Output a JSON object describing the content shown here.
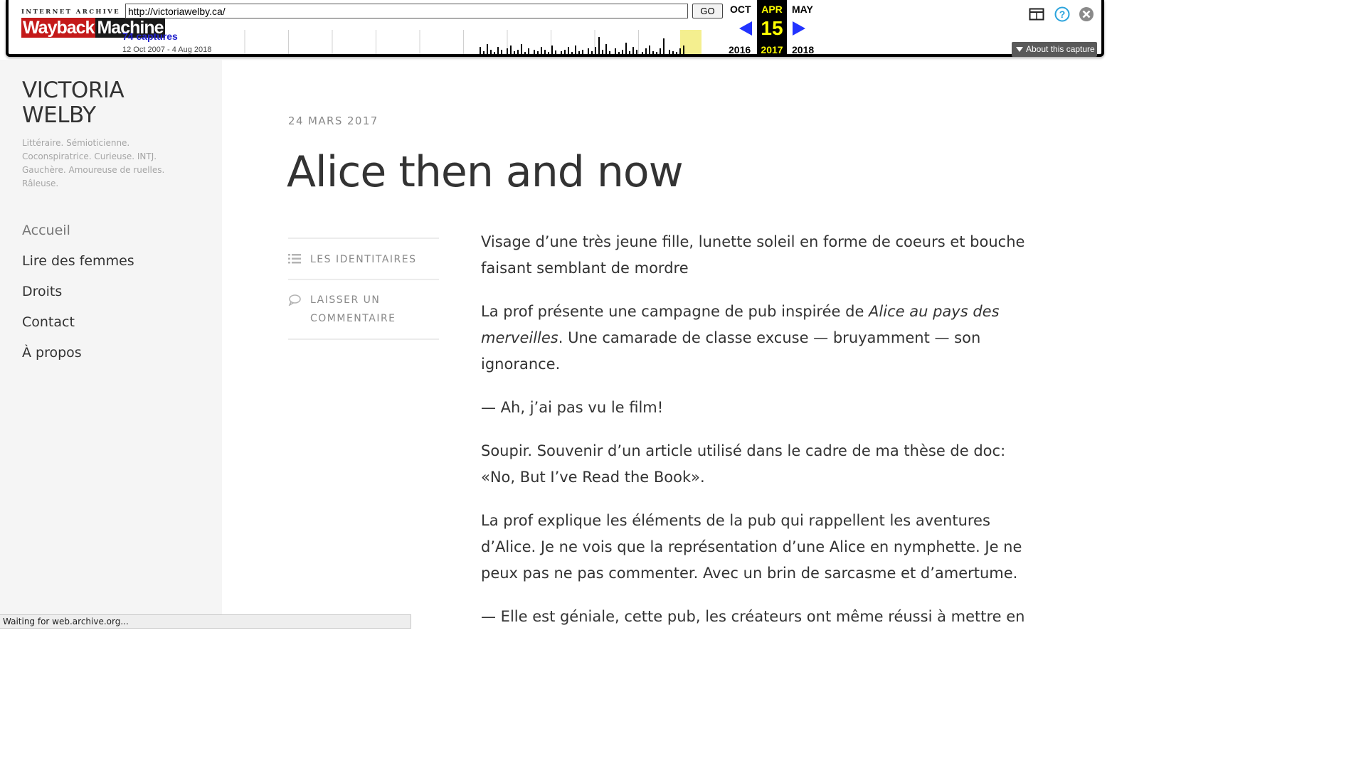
{
  "wayback": {
    "logo_top": "INTERNET ARCHIVE",
    "logo_main_a": "Wayback",
    "logo_main_b": "Machine",
    "url": "http://victoriawelby.ca/",
    "go_label": "GO",
    "captures": "74 captures",
    "range": "12 Oct 2007 - 4 Aug 2018",
    "prev_month": "OCT",
    "cur_month": "APR",
    "next_month": "MAY",
    "cur_day": "15",
    "prev_year": "2016",
    "cur_year": "2017",
    "next_year": "2018",
    "about_label": "About this capture",
    "accent_blue": "#2233ff",
    "highlight_yellow": "#ffff00"
  },
  "site": {
    "title_line1": "VICTORIA",
    "title_line2": "WELBY",
    "tagline_line1": "Littéraire. Sémioticienne.",
    "tagline_line2": "Coconspiratrice. Curieuse. INTJ.",
    "tagline_line3": "Gauchère. Amoureuse de ruelles.",
    "tagline_line4": "Râleuse.",
    "nav": [
      {
        "label": "Accueil"
      },
      {
        "label": "Lire des femmes"
      },
      {
        "label": "Droits"
      },
      {
        "label": "Contact"
      },
      {
        "label": "À propos"
      }
    ]
  },
  "post": {
    "date": "24 MARS 2017",
    "title": "Alice then and now",
    "category_label": "LES IDENTITAIRES",
    "comment_label_line1": "LAISSER UN",
    "comment_label_line2": "COMMENTAIRE",
    "p1": "Visage d’une très jeune fille, lunette soleil en forme de coeurs et bouche faisant semblant de mordre",
    "p2_before": "La prof présente une campagne de pub inspirée de ",
    "p2_em": "Alice au pays des merveilles",
    "p2_after": ". Une camarade de classe excuse — bruyamment — son ignorance.",
    "p3": "— Ah, j’ai pas vu le film!",
    "p4": "Soupir. Souvenir d’un article utilisé dans le cadre de ma thèse de doc: «No, But I’ve Read the Book».",
    "p5": "La prof explique les éléments de la pub qui rappellent les aventures d’Alice. Je ne vois que la représentation d’une Alice en nymphette. Je ne peux pas ne pas commenter. Avec un brin de sarcasme et d’amertume.",
    "p6": "— Elle est géniale, cette pub, les créateurs ont même réussi à mettre en"
  },
  "status": {
    "text": "Waiting for web.archive.org..."
  },
  "icons": {
    "window": "window-icon",
    "help": "help-icon",
    "close": "close-icon",
    "list": "list-icon",
    "comment": "comment-icon"
  }
}
